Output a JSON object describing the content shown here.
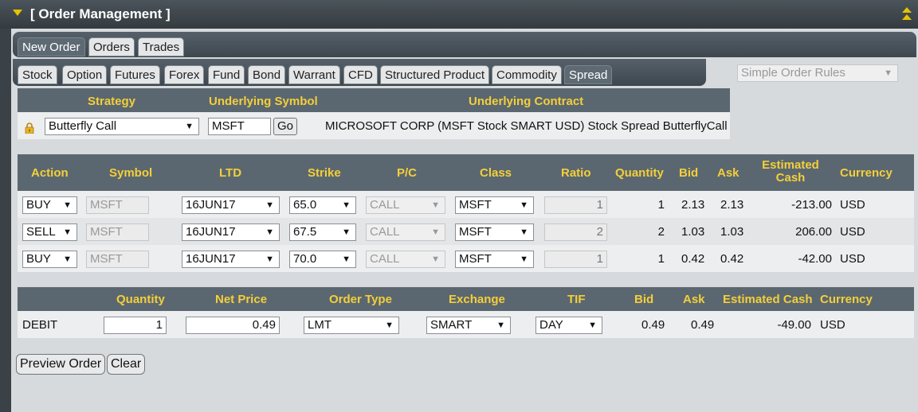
{
  "window": {
    "title": "[ Order Management ]"
  },
  "main_tabs": [
    {
      "label": "New Order",
      "active": true
    },
    {
      "label": "Orders"
    },
    {
      "label": "Trades"
    }
  ],
  "product_tabs": [
    {
      "label": "Stock"
    },
    {
      "label": "Option"
    },
    {
      "label": "Futures"
    },
    {
      "label": "Forex"
    },
    {
      "label": "Fund"
    },
    {
      "label": "Bond"
    },
    {
      "label": "Warrant"
    },
    {
      "label": "CFD"
    },
    {
      "label": "Structured Product"
    },
    {
      "label": "Commodity"
    },
    {
      "label": "Spread",
      "active": true
    }
  ],
  "rules_select": {
    "value": "Simple Order Rules"
  },
  "strategy": {
    "headers": {
      "strategy": "Strategy",
      "underlying_symbol": "Underlying Symbol",
      "underlying_contract": "Underlying Contract"
    },
    "strategy_value": "Butterfly Call",
    "symbol_value": "MSFT",
    "go_label": "Go",
    "contract_text": "MICROSOFT CORP (MSFT Stock SMART USD) Stock Spread ButterflyCall"
  },
  "legs": {
    "headers": [
      "Action",
      "Symbol",
      "LTD",
      "Strike",
      "P/C",
      "Class",
      "Ratio",
      "Quantity",
      "Bid",
      "Ask",
      "Estimated Cash",
      "Currency"
    ],
    "rows": [
      {
        "action": "BUY",
        "symbol": "MSFT",
        "ltd": "16JUN17",
        "strike": "65.0",
        "pc": "CALL",
        "class": "MSFT",
        "ratio": "1",
        "quantity": "1",
        "bid": "2.13",
        "ask": "2.13",
        "est_cash": "-213.00",
        "currency": "USD"
      },
      {
        "action": "SELL",
        "symbol": "MSFT",
        "ltd": "16JUN17",
        "strike": "67.5",
        "pc": "CALL",
        "class": "MSFT",
        "ratio": "2",
        "quantity": "2",
        "bid": "1.03",
        "ask": "1.03",
        "est_cash": "206.00",
        "currency": "USD"
      },
      {
        "action": "BUY",
        "symbol": "MSFT",
        "ltd": "16JUN17",
        "strike": "70.0",
        "pc": "CALL",
        "class": "MSFT",
        "ratio": "1",
        "quantity": "1",
        "bid": "0.42",
        "ask": "0.42",
        "est_cash": "-42.00",
        "currency": "USD"
      }
    ]
  },
  "order": {
    "headers": [
      "Quantity",
      "Net Price",
      "Order Type",
      "Exchange",
      "TIF",
      "Bid",
      "Ask",
      "Estimated Cash",
      "Currency"
    ],
    "side": "DEBIT",
    "quantity": "1",
    "net_price": "0.49",
    "order_type": "LMT",
    "exchange": "SMART",
    "tif": "DAY",
    "bid": "0.49",
    "ask": "0.49",
    "est_cash": "-49.00",
    "currency": "USD"
  },
  "buttons": {
    "preview": "Preview Order",
    "clear": "Clear"
  },
  "colors": {
    "header_bg": "#5b6770",
    "header_text": "#f3cf3a",
    "accent": "#e6c200"
  }
}
